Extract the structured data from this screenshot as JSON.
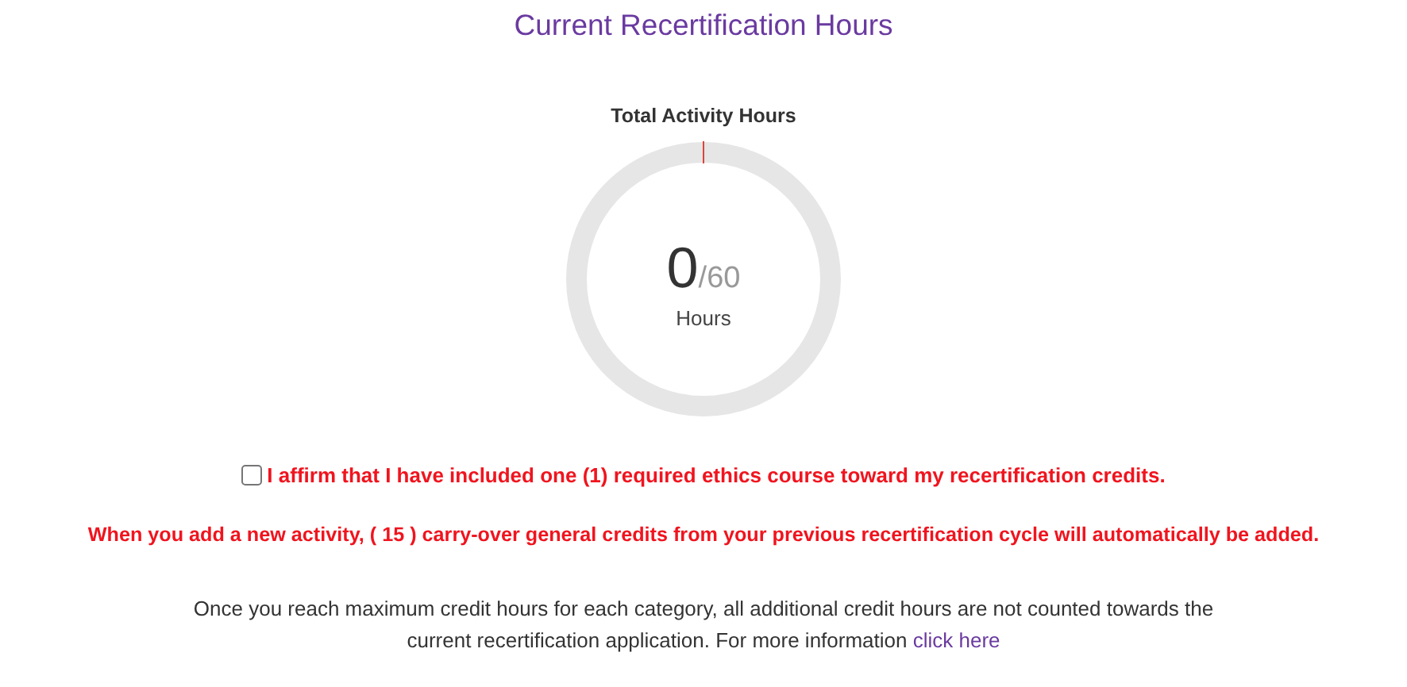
{
  "title": "Current Recertification Hours",
  "gauge": {
    "label": "Total Activity Hours",
    "value": "0",
    "total": "/60",
    "unit": "Hours",
    "level": 0
  },
  "affirmation": {
    "label": "I affirm that I have included one (1) required ethics course toward my recertification credits.",
    "checked": false
  },
  "notice": "When you add a new activity, ( 15 ) carry-over general credits from your previous recertification cycle will automatically be added.",
  "info": {
    "text": "Once you reach maximum credit hours for each category, all additional credit hours are not counted towards the current recertification application. For more information",
    "link": "click here"
  }
}
